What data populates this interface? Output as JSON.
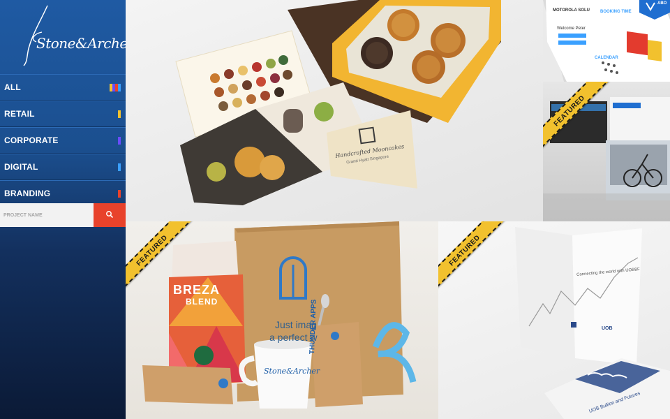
{
  "brand": {
    "logo_text": "Stone&Archer"
  },
  "menu": [
    {
      "label": "ALL",
      "colors": [
        "#f2c12e",
        "#6a4cff",
        "#e8422b",
        "#3aa0ff"
      ]
    },
    {
      "label": "RETAIL",
      "colors": [
        "#f2c12e"
      ]
    },
    {
      "label": "CORPORATE",
      "colors": [
        "#6a4cff"
      ]
    },
    {
      "label": "DIGITAL",
      "colors": [
        "#3aa0ff"
      ]
    },
    {
      "label": "BRANDING",
      "colors": [
        "#e8422b"
      ]
    }
  ],
  "search": {
    "placeholder": "PROJECT NAME",
    "icon": "search-icon",
    "button_color": "#e8422b"
  },
  "tiles": {
    "mooncake": {
      "card_title": "Handcrafted Mooncakes",
      "card_subtitle": "Grand Hyatt Singapore"
    },
    "dashboard": {
      "brand": "MOTOROLA SOLU",
      "welcome": "Welcome Peter",
      "booking_label": "BOOKING TIME",
      "calendar_label": "CALENDAR",
      "badge": "ABO"
    },
    "cycling": {
      "ribbon": "FEATURED"
    },
    "coffee": {
      "ribbon": "FEATURED",
      "bag_text_1": "BREZA",
      "bag_text_2": "BLEND",
      "box_text_1": "Just imag",
      "box_text_2": "a perfect w",
      "tag_text": "THUNDER APPS",
      "cup_signature": "Stone&Archer"
    },
    "uob": {
      "ribbon": "FEATURED",
      "cover_text": "Connecting the world with UOBBF",
      "brochure_title": "UOB Bullion and Futures",
      "logo": "UOB"
    }
  }
}
